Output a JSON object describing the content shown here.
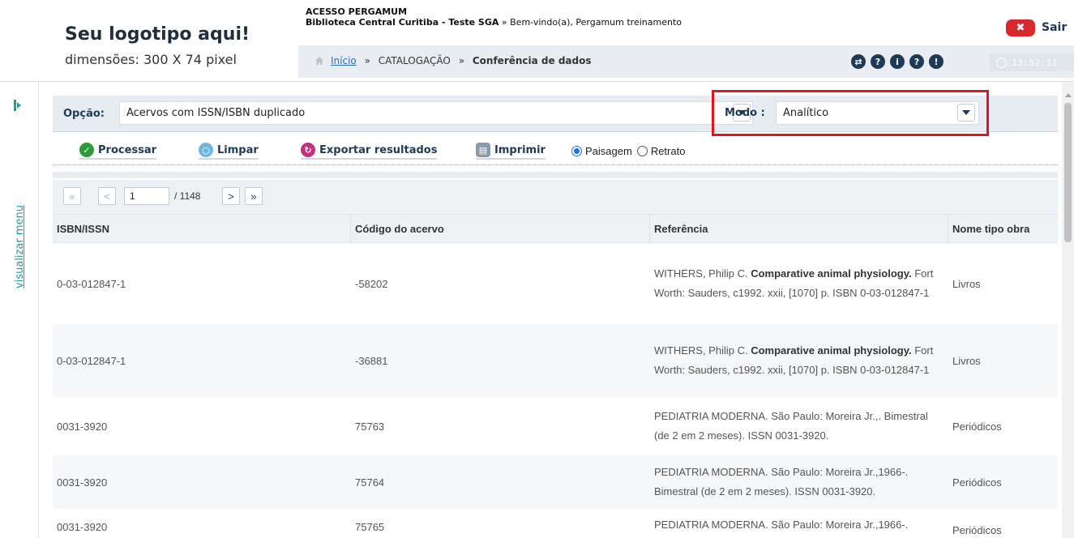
{
  "header": {
    "logo_title": "Seu logotipo aqui!",
    "logo_dims": "dimensões: 300 X 74 pixel",
    "access_title": "ACESSO PERGAMUM",
    "library": "Biblioteca Central Curitiba - Teste SGA",
    "welcome_sep": "»",
    "welcome": "Bem-vindo(a), Pergamum treinamento",
    "logout_x": "✖",
    "logout_label": "Sair",
    "clock": "13:52:11"
  },
  "breadcrumb": {
    "home": "Início",
    "sep": "»",
    "section": "CATALOGAÇÃO",
    "current": "Conferência de dados"
  },
  "toolbar_icons": [
    {
      "name": "exchange-icon",
      "glyph": "⇄"
    },
    {
      "name": "help-circle-icon",
      "glyph": "?"
    },
    {
      "name": "info-icon",
      "glyph": "i"
    },
    {
      "name": "question-icon",
      "glyph": "?"
    },
    {
      "name": "alert-icon",
      "glyph": "!"
    }
  ],
  "sidebar": {
    "label": "visualizar menu"
  },
  "filters": {
    "opcao_label": "Opção:",
    "opcao_value": "Acervos com ISSN/ISBN duplicado",
    "modo_label": "Modo :",
    "modo_value": "Analítico"
  },
  "actions": {
    "processar": "Processar",
    "limpar": "Limpar",
    "exportar": "Exportar resultados",
    "imprimir": "Imprimir",
    "paisagem": "Paisagem",
    "retrato": "Retrato",
    "orientation_selected": "Paisagem"
  },
  "pager": {
    "first": "«",
    "prev": "<",
    "page": "1",
    "total": "/ 1148",
    "next": ">",
    "last": "»"
  },
  "table": {
    "headers": [
      "ISBN/ISSN",
      "Código do acervo",
      "Referência",
      "Nome tipo obra"
    ],
    "rows": [
      {
        "isbn": "0-03-012847-1",
        "codigo": "-58202",
        "ref_pre": "WITHERS, Philip C. ",
        "ref_bold": "Comparative animal physiology.",
        "ref_post": " Fort Worth: Sauders, c1992. xxii, [1070] p. ISBN 0-03-012847-1",
        "tipo": "Livros"
      },
      {
        "isbn": "0-03-012847-1",
        "codigo": "-36881",
        "ref_pre": "WITHERS, Philip C. ",
        "ref_bold": "Comparative animal physiology.",
        "ref_post": " Fort Worth: Sauders, c1992. xxii, [1070] p. ISBN 0-03-012847-1",
        "tipo": "Livros"
      },
      {
        "isbn": "0031-3920",
        "codigo": "75763",
        "ref_pre": "PEDIATRIA MODERNA. São Paulo: Moreira Jr.,. Bimestral (de 2 em 2 meses). ISSN 0031-3920.",
        "ref_bold": "",
        "ref_post": "",
        "tipo": "Periódicos"
      },
      {
        "isbn": "0031-3920",
        "codigo": "75764",
        "ref_pre": "PEDIATRIA MODERNA. São Paulo: Moreira Jr.,1966-. Bimestral (de 2 em 2 meses). ISSN 0031-3920.",
        "ref_bold": "",
        "ref_post": "",
        "tipo": "Periódicos"
      },
      {
        "isbn": "0031-3920",
        "codigo": "75765",
        "ref_pre": "PEDIATRIA MODERNA. São Paulo: Moreira Jr.,1966-.",
        "ref_bold": "",
        "ref_post": "",
        "tipo": "Periódicos"
      }
    ]
  },
  "colors": {
    "accent_dark": "#1f3a57",
    "highlight": "#e0161c",
    "link": "#2a6fbf",
    "sidebar_link": "#1a9ea0"
  }
}
